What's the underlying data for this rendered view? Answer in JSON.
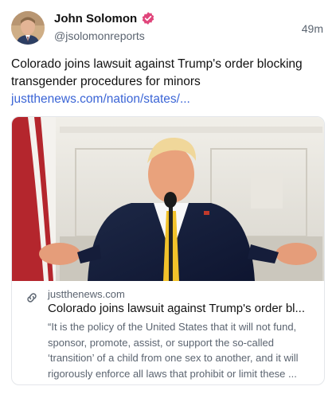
{
  "author": {
    "name": "John Solomon",
    "handle": "@jsolomonreports",
    "verified_color": "#e0457b"
  },
  "post": {
    "time": "49m",
    "text": "Colorado joins lawsuit against Trump's order blocking transgender procedures for minors ",
    "link_text": "justthenews.com/nation/states/..."
  },
  "link_card": {
    "domain": "justthenews.com",
    "title": "Colorado joins lawsuit against Trump's order bl...",
    "description": "“It is the policy of the United States that it will not fund, sponsor, promote, assist, or support the so-called ‘transition’ of a child from one sex to another, and it will rigorously enforce all laws that prohibit or limit these ..."
  },
  "colors": {
    "link": "#3b65d6",
    "muted": "#5b6470",
    "card_border": "#e3e6ea"
  }
}
